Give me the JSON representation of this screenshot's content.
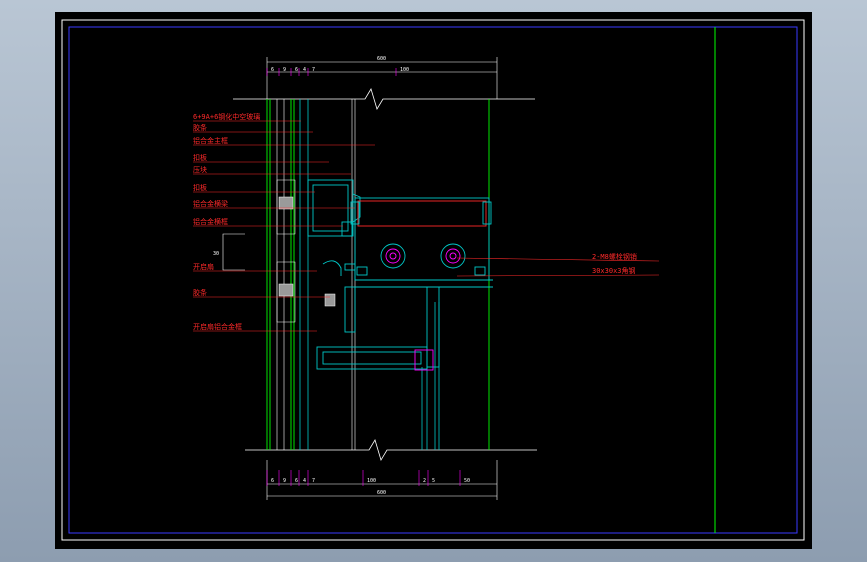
{
  "drawing": {
    "left_labels": [
      "6+9A+6钢化中空玻璃",
      "胶条",
      "铝合金主框",
      "扣板",
      "压块",
      "扣板",
      "铝合金横梁",
      "铝合金横框",
      "开启扇",
      "胶条",
      "开启扇铝合金框"
    ],
    "right_labels": [
      "2-M8螺栓钢销",
      "30x30x3角钢"
    ],
    "top_dims": [
      "6",
      "9",
      "6",
      "4",
      "7",
      "100"
    ],
    "top_total": "600",
    "bottom_dims": [
      "6",
      "9",
      "6",
      "4",
      "7",
      "100",
      "2",
      "5",
      "50"
    ],
    "bottom_total": "600",
    "side_dim": "30",
    "colors": {
      "background": "#000000",
      "frame": "#ffffff",
      "glass": "#00ff00",
      "profile": "#00c8c8",
      "leader": "#ff2a2a",
      "anchor": "#ff00ff"
    }
  }
}
